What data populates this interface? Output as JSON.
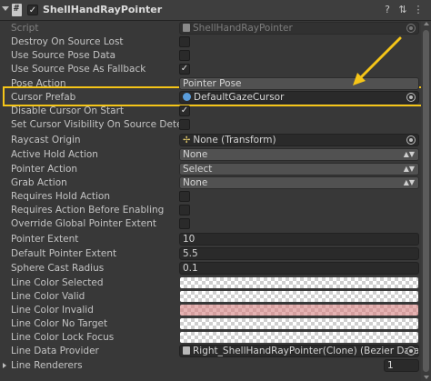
{
  "header": {
    "title": "ShellHandRayPointer",
    "enabled_check": "✓",
    "help_glyph": "?",
    "preset_glyph": "⇅",
    "menu_glyph": "⋮"
  },
  "fields": {
    "script": {
      "label": "Script",
      "value": "ShellHandRayPointer"
    },
    "destroy_on_source_lost": {
      "label": "Destroy On Source Lost",
      "check": ""
    },
    "use_source_pose_data": {
      "label": "Use Source Pose Data",
      "check": ""
    },
    "use_source_pose_fallback": {
      "label": "Use Source Pose As Fallback",
      "check": "✓"
    },
    "pose_action": {
      "label": "Pose Action",
      "value": "Pointer Pose"
    },
    "cursor_prefab": {
      "label": "Cursor Prefab",
      "value": "DefaultGazeCursor"
    },
    "disable_cursor_on_start": {
      "label": "Disable Cursor On Start",
      "check": "✓"
    },
    "set_cursor_visibility": {
      "label": "Set Cursor Visibility On Source Detected",
      "check": ""
    },
    "raycast_origin": {
      "label": "Raycast Origin",
      "value": "None (Transform)"
    },
    "active_hold_action": {
      "label": "Active Hold Action",
      "value": "None"
    },
    "pointer_action": {
      "label": "Pointer Action",
      "value": "Select"
    },
    "grab_action": {
      "label": "Grab Action",
      "value": "None"
    },
    "requires_hold_action": {
      "label": "Requires Hold Action",
      "check": ""
    },
    "requires_action_before_enabling": {
      "label": "Requires Action Before Enabling",
      "check": ""
    },
    "override_global_pointer_extent": {
      "label": "Override Global Pointer Extent",
      "check": ""
    },
    "pointer_extent": {
      "label": "Pointer Extent",
      "value": "10"
    },
    "default_pointer_extent": {
      "label": "Default Pointer Extent",
      "value": "5.5"
    },
    "sphere_cast_radius": {
      "label": "Sphere Cast Radius",
      "value": "0.1"
    },
    "line_color_selected": {
      "label": "Line Color Selected"
    },
    "line_color_valid": {
      "label": "Line Color Valid"
    },
    "line_color_invalid": {
      "label": "Line Color Invalid"
    },
    "line_color_no_target": {
      "label": "Line Color No Target"
    },
    "line_color_lock_focus": {
      "label": "Line Color Lock Focus"
    },
    "line_data_provider": {
      "label": "Line Data Provider",
      "value": "Right_ShellHandRayPointer(Clone) (Bezier Data Prov"
    },
    "line_renderers": {
      "label": "Line Renderers",
      "value": "1"
    }
  },
  "annotation": {
    "color": "#f5c518"
  }
}
